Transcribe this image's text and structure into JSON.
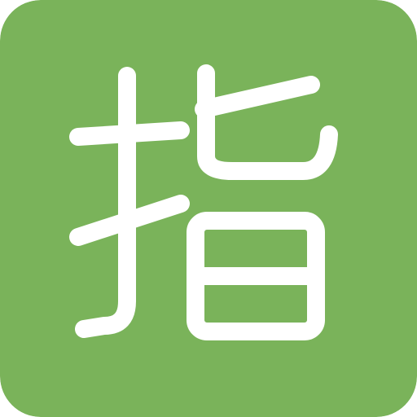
{
  "icon": {
    "glyph": "指",
    "background_color": "#7AB35A",
    "glyph_color": "#FFFFFF",
    "icon_name": "finger-kanji-icon"
  }
}
